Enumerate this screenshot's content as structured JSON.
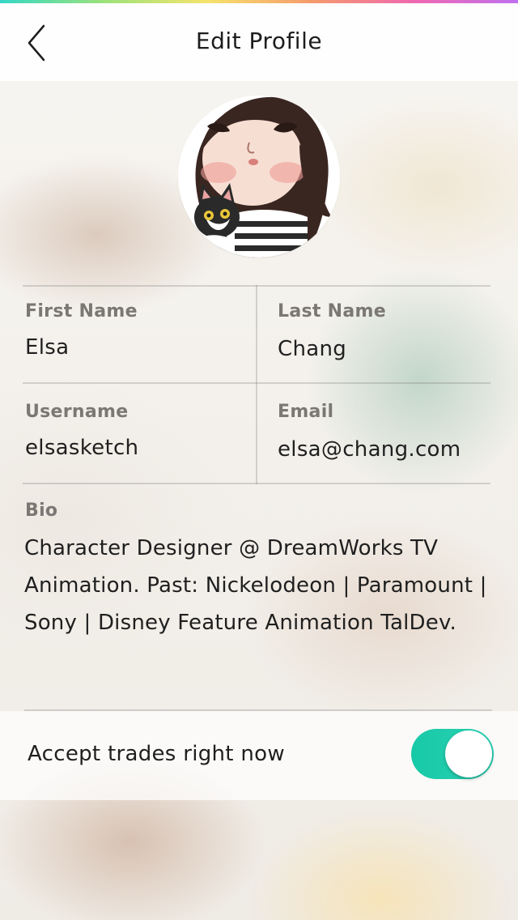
{
  "header": {
    "title": "Edit Profile",
    "back_icon": "chevron-left-icon"
  },
  "profile": {
    "avatar_icon": "profile-avatar-illustration"
  },
  "fields": {
    "first_name": {
      "label": "First Name",
      "value": "Elsa"
    },
    "last_name": {
      "label": "Last Name",
      "value": "Chang"
    },
    "username": {
      "label": "Username",
      "value": "elsasketch"
    },
    "email": {
      "label": "Email",
      "value": "elsa@chang.com"
    },
    "bio": {
      "label": "Bio",
      "value": "Character Designer @ DreamWorks TV Animation. Past: Nickelodeon | Paramount | Sony | Disney Feature Animation TalDev."
    }
  },
  "trades": {
    "label": "Accept trades right now",
    "enabled": true
  },
  "colors": {
    "accent": "#1ecdb0",
    "label_gray": "#7a7774",
    "text": "#1f1f1f"
  }
}
